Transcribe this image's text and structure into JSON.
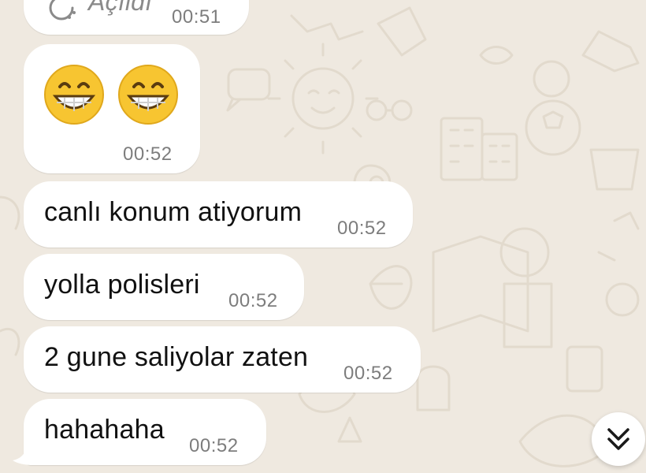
{
  "chat": {
    "messages": [
      {
        "text": "Açıldı",
        "time": "00:51",
        "type": "partial-status"
      },
      {
        "text": "😁😁",
        "time": "00:52",
        "type": "emoji"
      },
      {
        "text": "canlı konum atiyorum",
        "time": "00:52",
        "type": "text"
      },
      {
        "text": "yolla polisleri",
        "time": "00:52",
        "type": "text"
      },
      {
        "text": "2 gune saliyolar zaten",
        "time": "00:52",
        "type": "text"
      },
      {
        "text": "hahahaha",
        "time": "00:52",
        "type": "text"
      }
    ]
  },
  "controls": {
    "scroll_down_icon": "double-chevron-down-icon"
  },
  "colors": {
    "background": "#efe9e0",
    "bubble": "#ffffff",
    "text": "#111111",
    "timestamp": "#7d7d7d",
    "emoji_face": "#f7c531"
  }
}
